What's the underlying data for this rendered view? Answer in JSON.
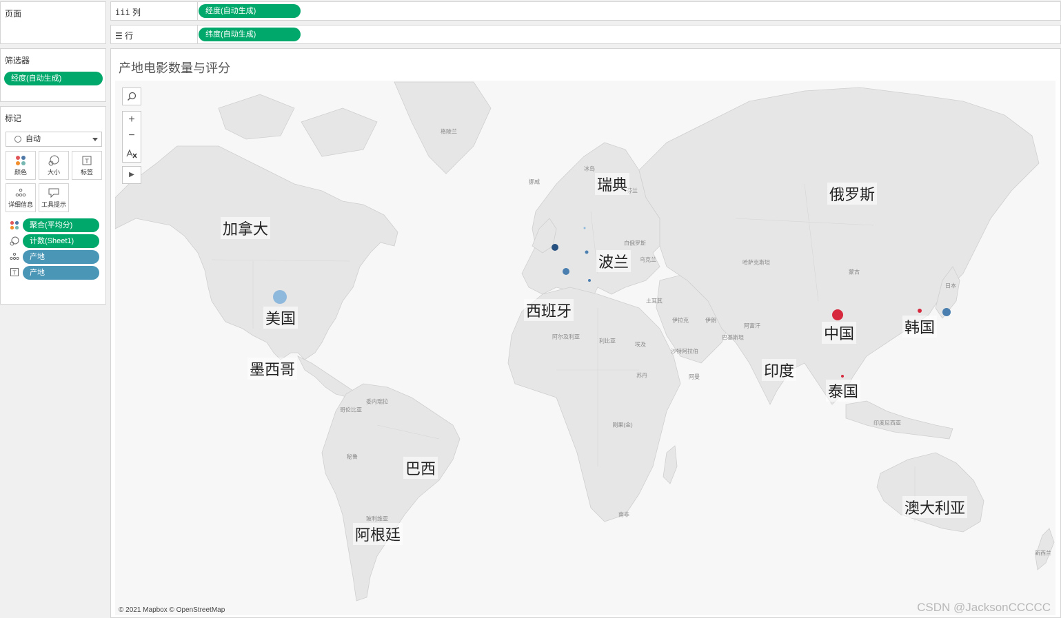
{
  "pages_panel": {
    "title": "页面"
  },
  "filters_panel": {
    "title": "筛选器",
    "pill": "经度(自动生成)"
  },
  "marks_panel": {
    "title": "标记",
    "mark_type": "自动",
    "buttons": [
      {
        "label": "颜色",
        "icon": "color-icon"
      },
      {
        "label": "大小",
        "icon": "size-icon"
      },
      {
        "label": "标签",
        "icon": "label-icon"
      },
      {
        "label": "详细信息",
        "icon": "detail-icon"
      },
      {
        "label": "工具提示",
        "icon": "tooltip-icon"
      }
    ],
    "fields": [
      {
        "label": "聚合(平均分)",
        "icon": "color-icon",
        "kind": "green"
      },
      {
        "label": "计数(Sheet1)",
        "icon": "size-icon",
        "kind": "green"
      },
      {
        "label": "产地",
        "icon": "detail-icon",
        "kind": "blue"
      },
      {
        "label": "产地",
        "icon": "label-icon",
        "kind": "blue"
      }
    ]
  },
  "columns_shelf": {
    "label": "列",
    "icon": "columns-icon",
    "pill": "经度(自动生成)"
  },
  "rows_shelf": {
    "label": "行",
    "icon": "rows-icon",
    "pill": "纬度(自动生成)"
  },
  "worksheet": {
    "title": "产地电影数量与评分",
    "attribution": "© 2021 Mapbox © OpenStreetMap",
    "watermark": "CSDN @JacksonCCCCC"
  },
  "map_tools": [
    "search-icon",
    "zoom-in-icon",
    "zoom-out-icon",
    "reset-icon",
    "expand-icon"
  ],
  "map": {
    "country_labels": [
      "瑞典",
      "俄罗斯",
      "加拿大",
      "波兰",
      "西班牙",
      "美国",
      "中国",
      "韩国",
      "墨西哥",
      "印度",
      "泰国",
      "巴西",
      "澳大利亚",
      "阿根廷"
    ],
    "minor_labels": [
      "格陵兰",
      "冰岛",
      "挪威",
      "芬兰",
      "白俄罗斯",
      "乌克兰",
      "哈萨克斯坦",
      "蒙古",
      "土耳其",
      "伊拉克",
      "伊朗",
      "阿富汗",
      "巴基斯坦",
      "沙特阿拉伯",
      "阿曼",
      "阿尔及利亚",
      "利比亚",
      "埃及",
      "苏丹",
      "刚果(金)",
      "南非",
      "印度尼西亚",
      "新西兰",
      "委内瑞拉",
      "哥伦比亚",
      "秘鲁",
      "玻利维亚",
      "日本"
    ],
    "marks_color_legend": {
      "high": "#d6293d",
      "mid": "#4a7fb0",
      "low": "#8fb8dd",
      "dark": "#25507f"
    }
  }
}
